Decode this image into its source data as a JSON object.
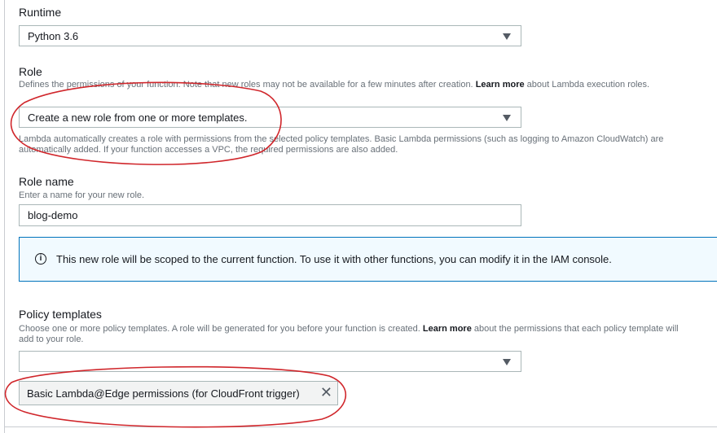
{
  "runtime": {
    "label": "Runtime",
    "value": "Python 3.6"
  },
  "role": {
    "label": "Role",
    "desc_prefix": "Defines the permissions of your function. Note that new roles may not be available for a few minutes after creation.",
    "desc_link": "Learn more",
    "desc_suffix": "about Lambda execution roles.",
    "value": "Create a new role from one or more templates.",
    "help": "Lambda automatically creates a role with permissions from the selected policy templates. Basic Lambda permissions (such as logging to Amazon CloudWatch) are automatically added. If your function accesses a VPC, the required permissions are also added."
  },
  "role_name": {
    "label": "Role name",
    "hint": "Enter a name for your new role.",
    "value": "blog-demo"
  },
  "info_alert": {
    "icon": "info-icon",
    "text": "This new role will be scoped to the current function. To use it with other functions, you can modify it in the IAM console."
  },
  "policy_templates": {
    "label": "Policy templates",
    "desc_prefix": "Choose one or more policy templates. A role will be generated for you before your function is created.",
    "desc_link": "Learn more",
    "desc_suffix": "about the permissions that each policy template will add to your role.",
    "value": "",
    "selected_token": "Basic Lambda@Edge permissions (for CloudFront trigger)"
  },
  "colors": {
    "annotation": "#d0262b",
    "info_border": "#0073bb",
    "info_bg": "#f1faff"
  }
}
